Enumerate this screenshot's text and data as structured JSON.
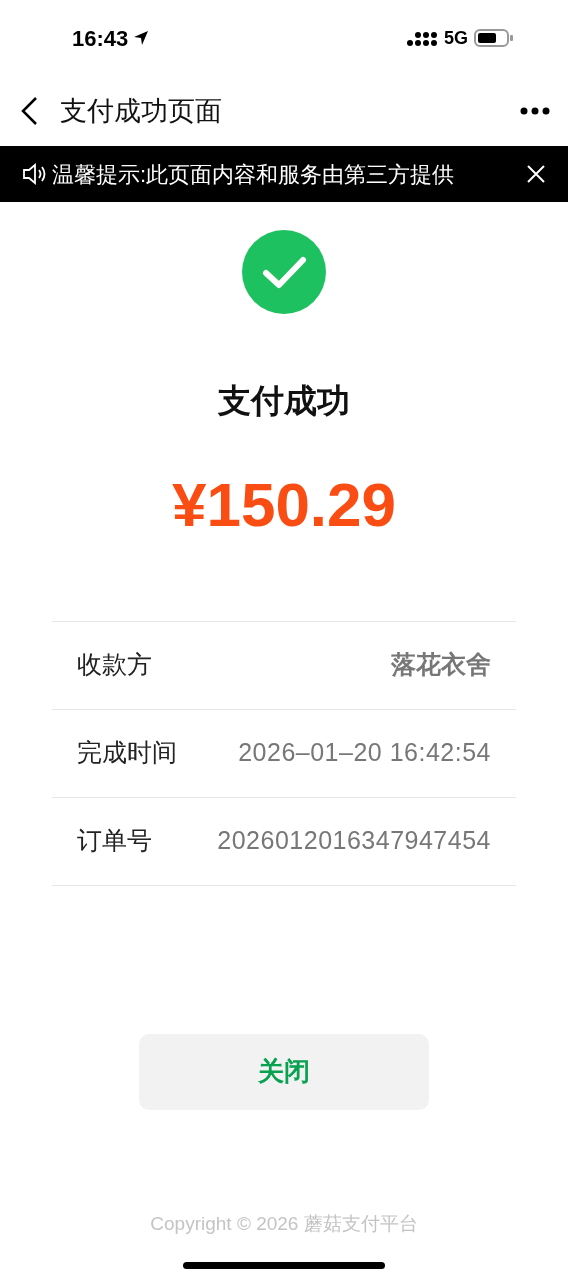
{
  "status_bar": {
    "time": "16:43",
    "network": "5G"
  },
  "nav": {
    "title": "支付成功页面"
  },
  "notice": {
    "text": "温馨提示:此页面内容和服务由第三方提供"
  },
  "result": {
    "title": "支付成功",
    "amount": "¥150.29"
  },
  "details": [
    {
      "kind": "strong",
      "label": "收款方",
      "value": "落花衣舍"
    },
    {
      "kind": "plain",
      "label": "完成时间",
      "value": "2026–01–20 16:42:54"
    },
    {
      "kind": "plain",
      "label": "订单号",
      "value": "2026012016347947454"
    }
  ],
  "button": {
    "label": "关闭"
  },
  "footer": "Copyright © 2026 蘑菇支付平台"
}
